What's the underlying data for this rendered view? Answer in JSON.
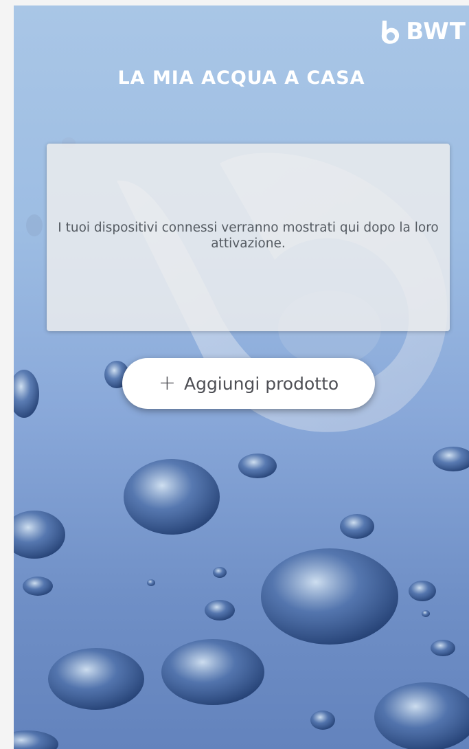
{
  "header": {
    "brand": "BWT",
    "title": "LA MIA ACQUA A CASA"
  },
  "main": {
    "empty_message": "I tuoi dispositivi connessi verranno mostrati qui dopo la loro attivazione.",
    "add_button_label": "Aggiungi prodotto",
    "add_button_icon": "plus-icon"
  },
  "colors": {
    "background_top": "#a9c6e6",
    "background_bottom": "#6383bd",
    "card": "#eeeeee",
    "text": "#555b62",
    "button": "#ffffff"
  }
}
